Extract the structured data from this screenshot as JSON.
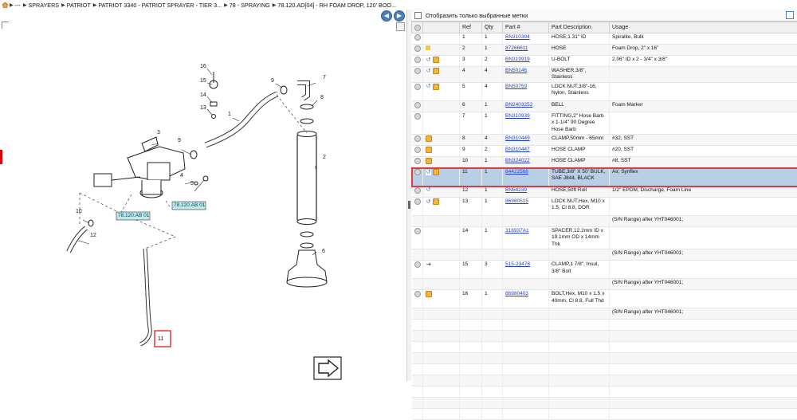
{
  "breadcrumb": {
    "items": [
      "---",
      "SPRAYERS",
      "PATRIOT",
      "PATRIOT 3340 - PATRIOT SPRAYER - TIER 3...",
      "78 - SPRAYING",
      "78.120.AD[04] - RH FOAM DROP, 120' BOO..."
    ]
  },
  "diagram": {
    "refs": [
      "1",
      "2",
      "3",
      "4",
      "5",
      "6",
      "7",
      "8",
      "9",
      "9",
      "10",
      "11",
      "12",
      "13",
      "14",
      "15",
      "16"
    ],
    "callouts": [
      "78.120.AB 01",
      "78.120.AB 01"
    ]
  },
  "filter": {
    "label": "Отобразить только выбранные метки"
  },
  "table": {
    "headers": [
      "Ref",
      "Qty",
      "Part #",
      "Part Description",
      "Usage"
    ],
    "rows": [
      {
        "ref": "1",
        "qty": "1",
        "part": "BN310394",
        "desc": "HOSE,1.31\" ID",
        "usage": "Spiralite, Bulk",
        "icons": [
          "grey"
        ]
      },
      {
        "ref": "2",
        "qty": "1",
        "part": "87266611",
        "desc": "HOSE",
        "usage": "Foam Drop, 2\" x 16\"",
        "icons": [
          "grey",
          "star"
        ]
      },
      {
        "ref": "3",
        "qty": "2",
        "part": "BN319919",
        "desc": "U-BOLT",
        "usage": "2.06\" ID x 2 - 3/4\" x 3/8\"",
        "icons": [
          "grey",
          "blue",
          "box"
        ]
      },
      {
        "ref": "4",
        "qty": "4",
        "part": "BN50146",
        "desc": "WASHER,3/8\", Stainless",
        "usage": "",
        "icons": [
          "grey",
          "blue",
          "box"
        ]
      },
      {
        "ref": "5",
        "qty": "4",
        "part": "BN50759",
        "desc": "LOCK NUT,3/8\"-16, Nylon, Stainless",
        "usage": "",
        "icons": [
          "grey",
          "blue",
          "box"
        ]
      },
      {
        "ref": "6",
        "qty": "1",
        "part": "BN2403252",
        "desc": "BELL",
        "usage": "Foam Marker",
        "icons": [
          "grey"
        ]
      },
      {
        "ref": "7",
        "qty": "1",
        "part": "BN310939",
        "desc": "FITTING,2\" Hose Barb x 1-1/4\" 90 Degree Hose Barb",
        "usage": "",
        "icons": [
          "grey"
        ]
      },
      {
        "ref": "8",
        "qty": "4",
        "part": "BN310449",
        "desc": "CLAMP,50mm - 65mm",
        "usage": "#32, SST",
        "icons": [
          "grey",
          "box"
        ]
      },
      {
        "ref": "9",
        "qty": "2",
        "part": "BN310447",
        "desc": "HOSE CLAMP",
        "usage": "#20, SST",
        "icons": [
          "grey",
          "box"
        ]
      },
      {
        "ref": "10",
        "qty": "1",
        "part": "BN324022",
        "desc": "HOSE CLAMP",
        "usage": "#8, SST",
        "icons": [
          "grey",
          "box"
        ]
      },
      {
        "ref": "11",
        "qty": "1",
        "part": "84422568",
        "desc": "TUBE,3/8\" X 50' BULK, SAE J844, BLACK",
        "usage": "Air, Synflex",
        "icons": [
          "grey",
          "blue",
          "box"
        ]
      },
      {
        "ref": "12",
        "qty": "1",
        "part": "BN54239",
        "desc": "HOSE,50ft Roll",
        "usage": "1/2\" EPDM, Discharge, Foam Line",
        "icons": [
          "grey",
          "blue"
        ]
      },
      {
        "ref": "13",
        "qty": "1",
        "part": "86980515",
        "desc": "LOCK NUT,Hex, M10 x 1.5, Cl 8.8, DOR",
        "usage": "",
        "icons": [
          "grey",
          "blue",
          "box"
        ]
      },
      {
        "ref": "",
        "qty": "",
        "part": "",
        "desc": "",
        "usage": "(S/N Range) after YHT046001;",
        "icons": []
      },
      {
        "ref": "14",
        "qty": "1",
        "part": "316937A1",
        "desc": "SPACER,12.2mm ID x 19.1mm OD x 14mm Thk",
        "usage": "",
        "icons": [
          "grey"
        ]
      },
      {
        "ref": "",
        "qty": "",
        "part": "",
        "desc": "",
        "usage": "(S/N Range) after YHT046001;",
        "icons": []
      },
      {
        "ref": "15",
        "qty": "3",
        "part": "515-23476",
        "desc": "CLAMP,1 7/8\", Insul, 3/8\" Bolt",
        "usage": "",
        "icons": [
          "grey",
          "green"
        ]
      },
      {
        "ref": "",
        "qty": "",
        "part": "",
        "desc": "",
        "usage": "(S/N Range) after YHT046001;",
        "icons": []
      },
      {
        "ref": "16",
        "qty": "1",
        "part": "86980403",
        "desc": "BOLT,Hex, M10 x 1.5 x 40mm, Cl 8.8, Full Thd",
        "usage": "",
        "icons": [
          "grey",
          "box"
        ]
      },
      {
        "ref": "",
        "qty": "",
        "part": "",
        "desc": "",
        "usage": "(S/N Range) after YHT046001;",
        "icons": []
      }
    ],
    "selected_ref": "11"
  }
}
